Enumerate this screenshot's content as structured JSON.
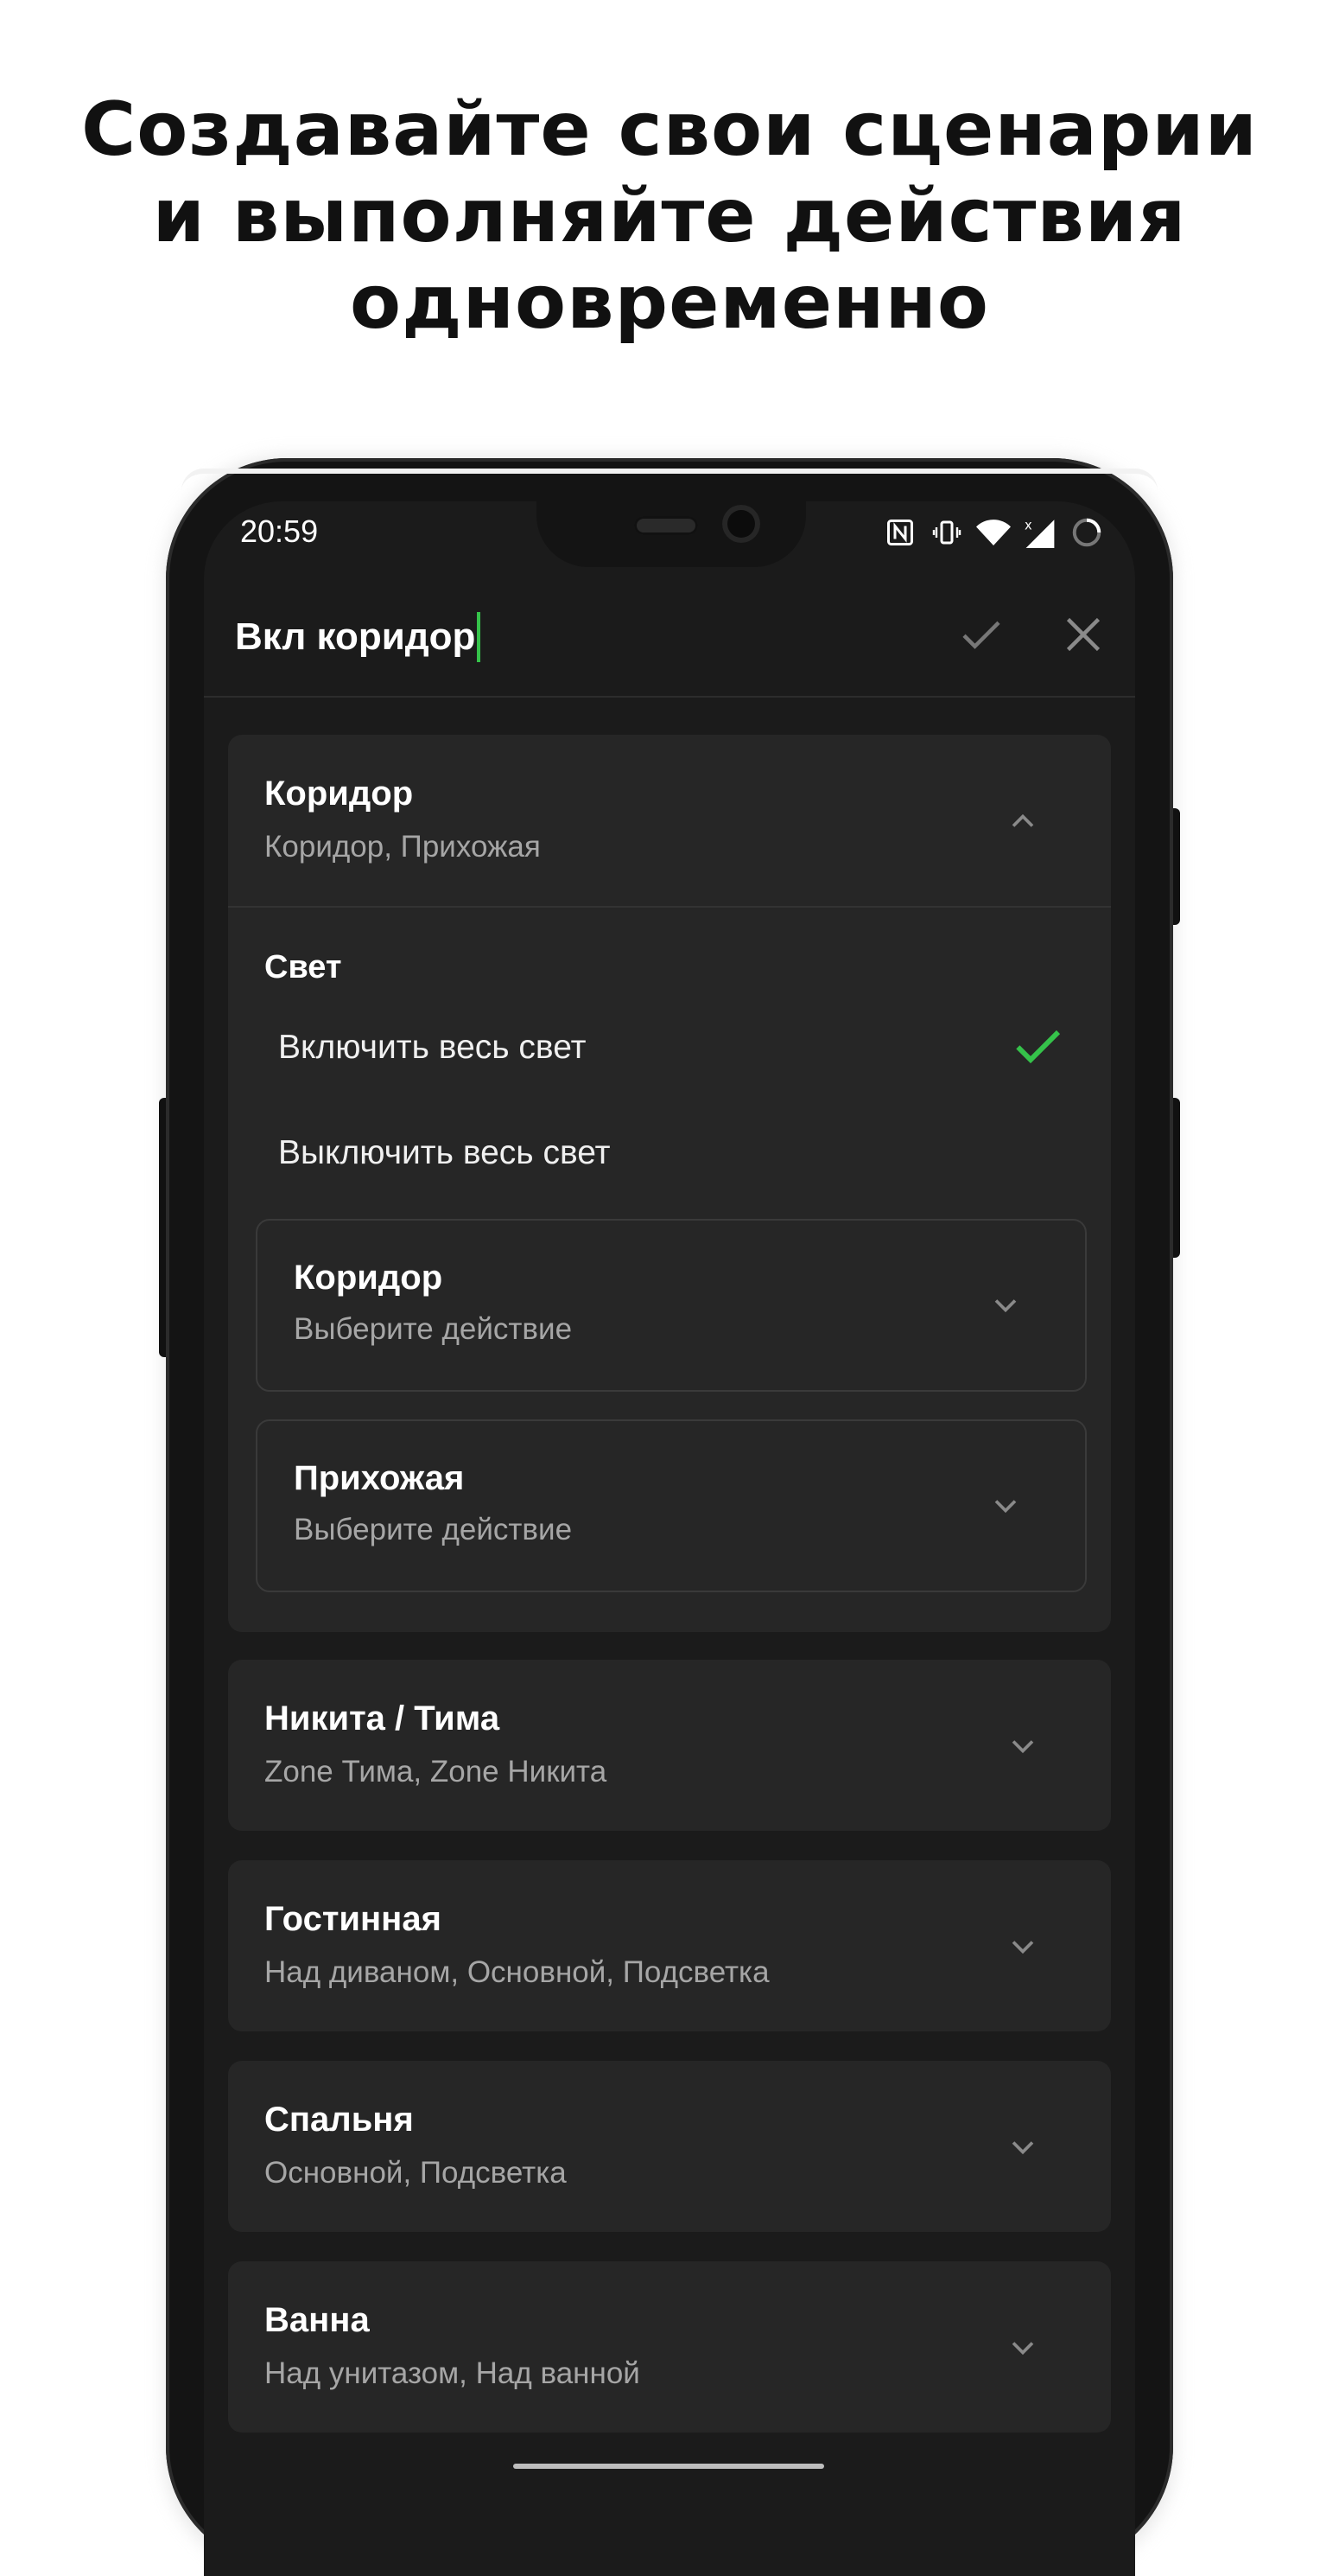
{
  "promo": {
    "line1": "Создавайте свои сценарии",
    "line2": "и выполняйте действия",
    "line3": "одновременно"
  },
  "status_bar": {
    "time": "20:59",
    "icons": [
      "nfc-icon",
      "vibrate-icon",
      "wifi-icon",
      "signal-icon",
      "battery-icon"
    ]
  },
  "appbar": {
    "title": "Вкл коридор",
    "confirm_icon": "check-icon",
    "close_icon": "close-icon"
  },
  "accent": "#35c24a",
  "rooms": [
    {
      "title": "Коридор",
      "subtitle": "Коридор, Прихожая",
      "expanded": true,
      "section": "Свет",
      "options": [
        {
          "label": "Включить весь свет",
          "selected": true
        },
        {
          "label": "Выключить весь свет",
          "selected": false
        }
      ],
      "devices": [
        {
          "title": "Коридор",
          "subtitle": "Выберите действие"
        },
        {
          "title": "Прихожая",
          "subtitle": "Выберите действие"
        }
      ]
    },
    {
      "title": "Никита / Тима",
      "subtitle": "Zone Тима, Zone Никита",
      "expanded": false
    },
    {
      "title": "Гостинная",
      "subtitle": "Над диваном, Основной, Подсветка",
      "expanded": false
    },
    {
      "title": "Спальня",
      "subtitle": "Основной, Подсветка",
      "expanded": false
    },
    {
      "title": "Ванна",
      "subtitle": "Над унитазом, Над ванной",
      "expanded": false
    }
  ]
}
